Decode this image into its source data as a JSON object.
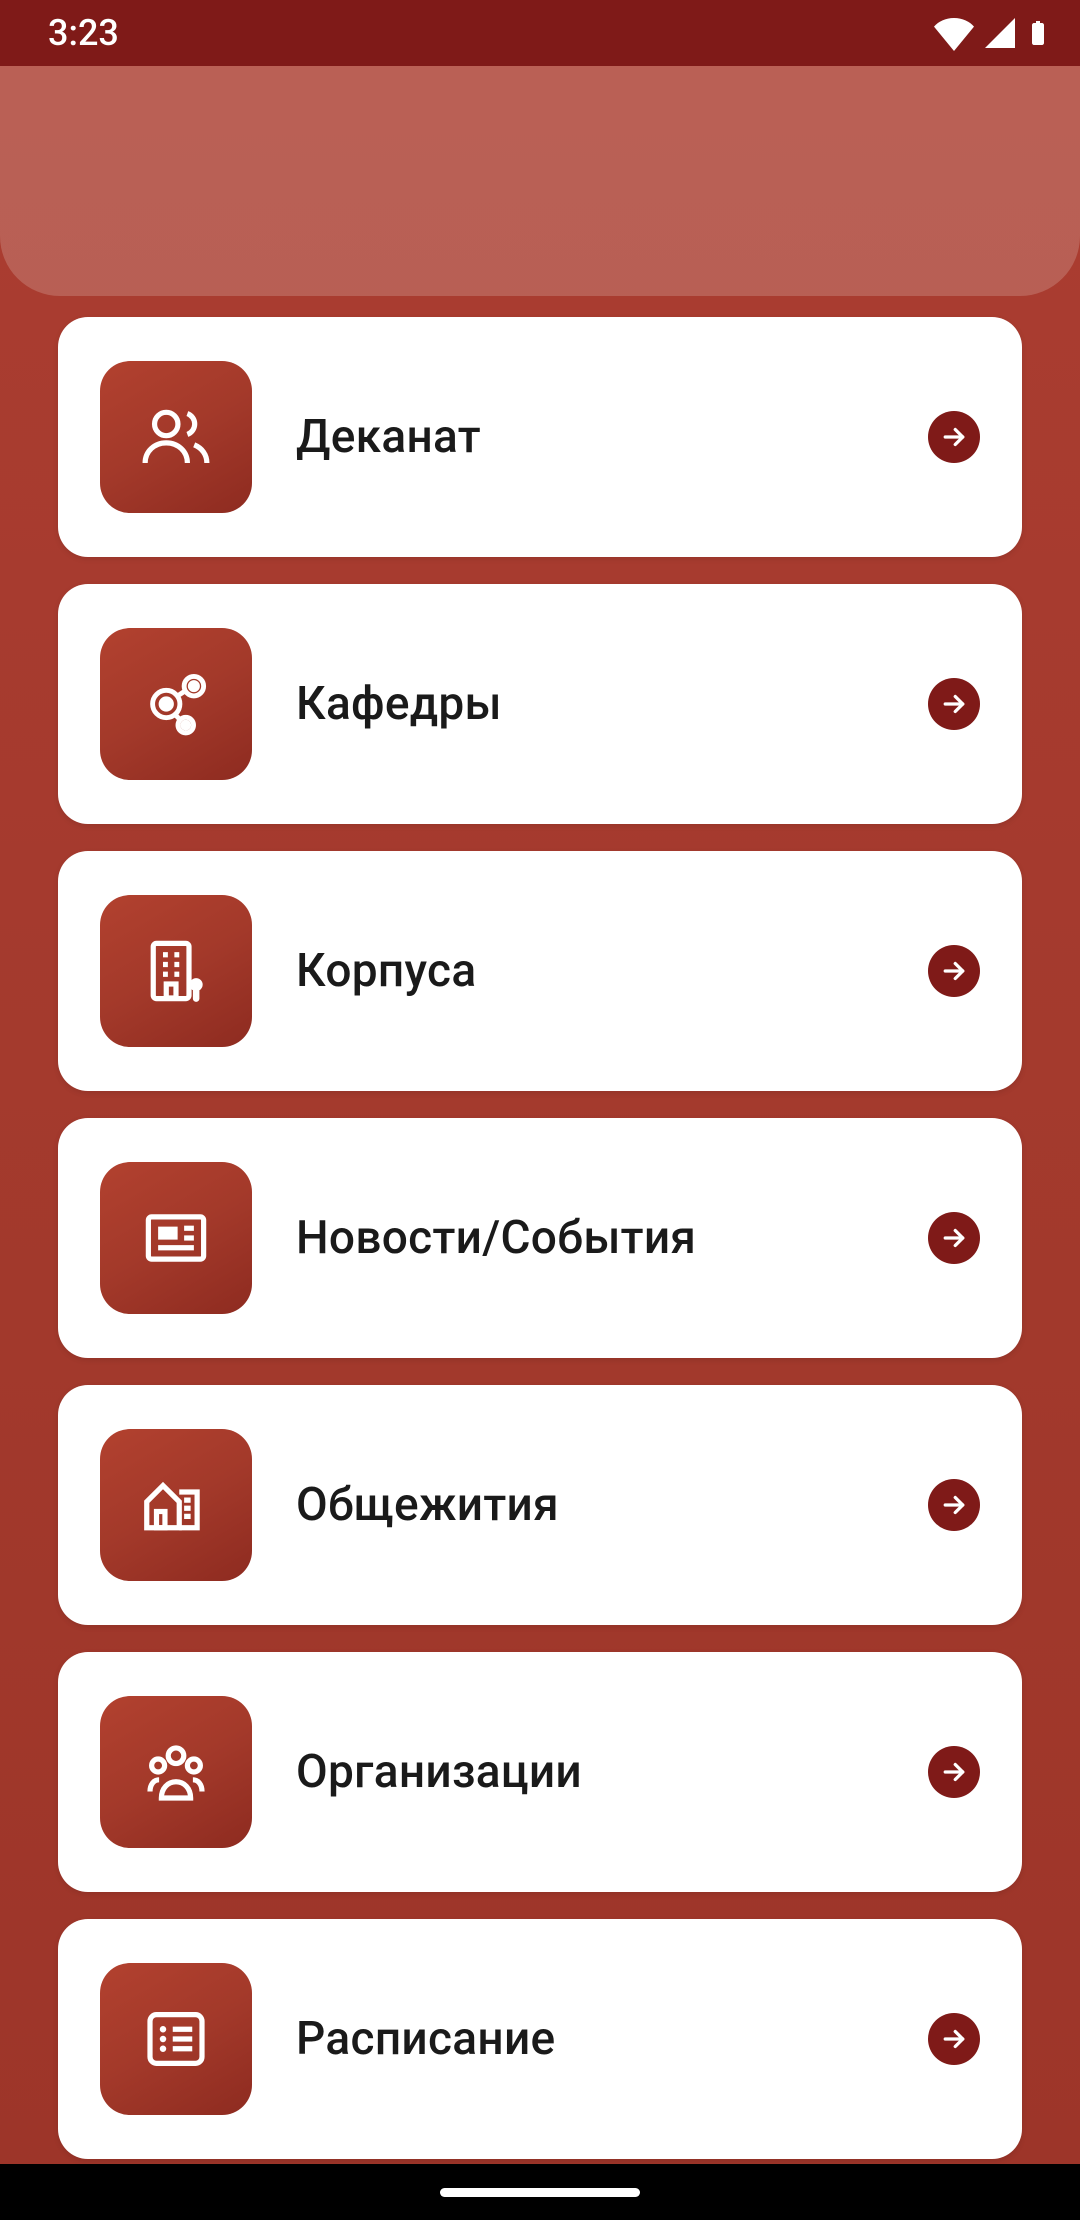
{
  "status": {
    "time": "3:23"
  },
  "menu": {
    "items": [
      {
        "id": "deanery",
        "label": "Деканат",
        "icon": "people-outline"
      },
      {
        "id": "departments",
        "label": "Кафедры",
        "icon": "people-nodes"
      },
      {
        "id": "buildings",
        "label": "Корпуса",
        "icon": "building-pin"
      },
      {
        "id": "news",
        "label": "Новости/События",
        "icon": "newspaper"
      },
      {
        "id": "dorms",
        "label": "Общежития",
        "icon": "houses"
      },
      {
        "id": "organizations",
        "label": "Организации",
        "icon": "group-circle"
      },
      {
        "id": "schedule",
        "label": "Расписание",
        "icon": "list-box"
      }
    ]
  }
}
